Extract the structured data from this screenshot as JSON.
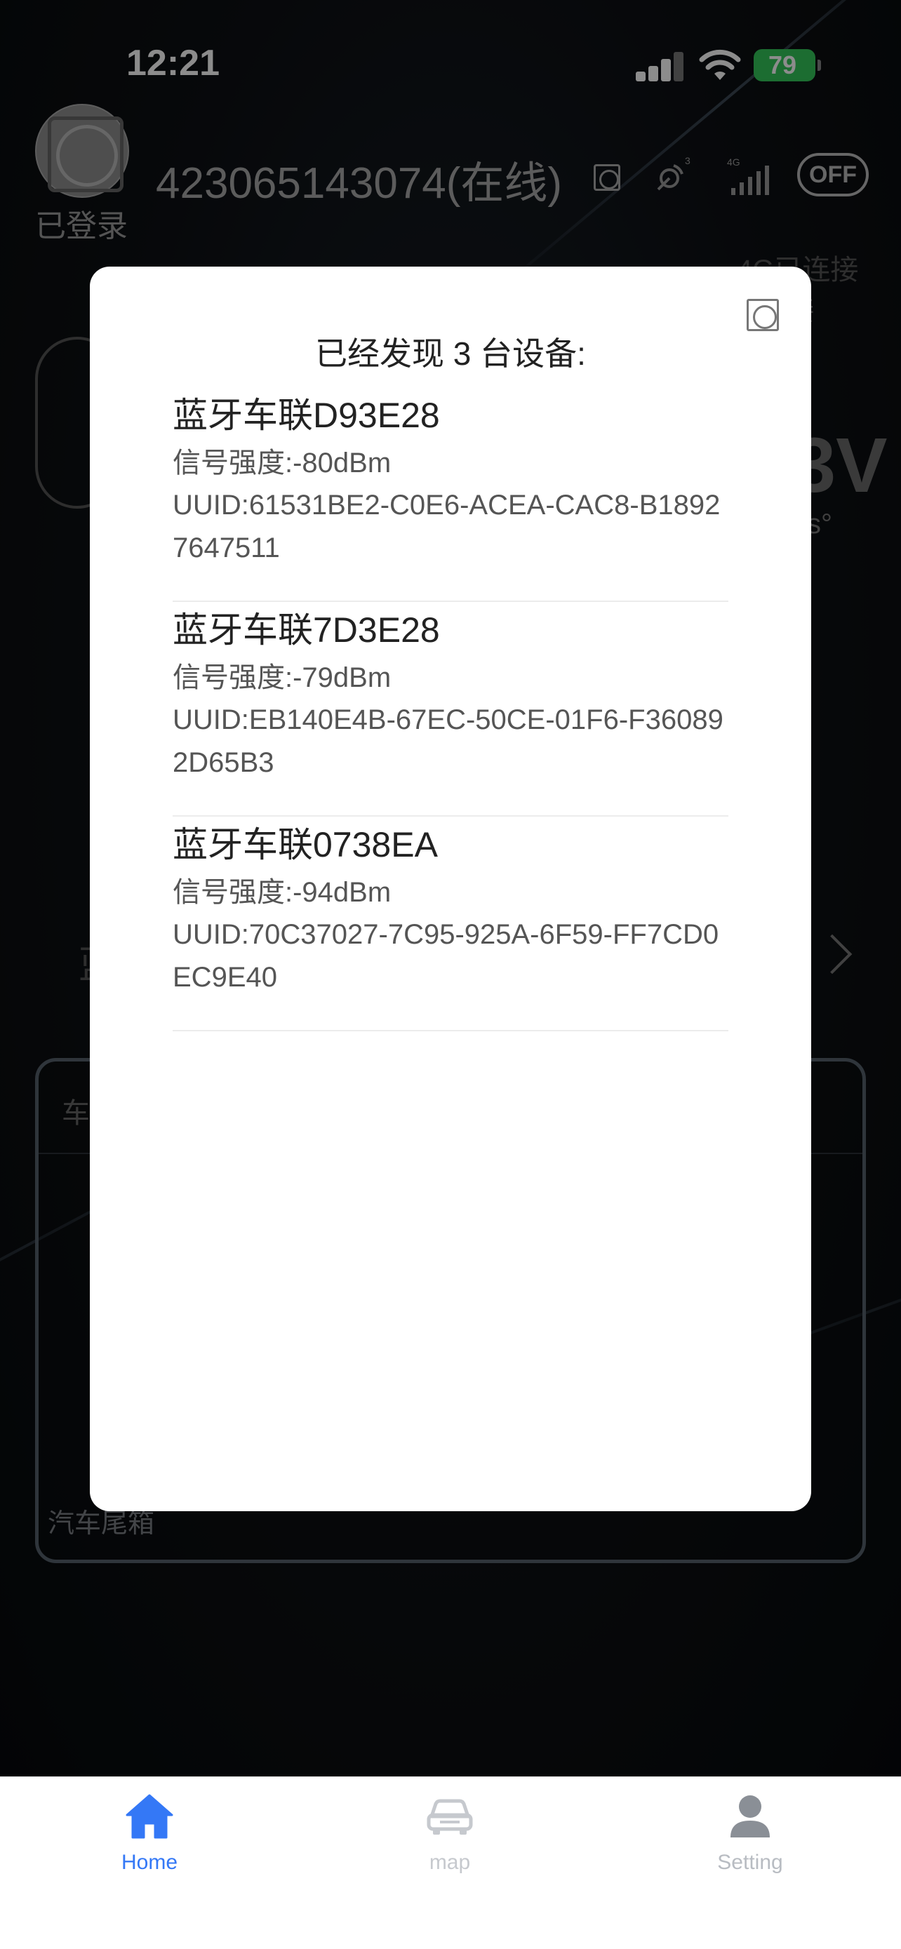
{
  "status_bar": {
    "time": "12:21",
    "battery": "79"
  },
  "background": {
    "login_label": "已登录",
    "device_id": "423065143074(在线)",
    "sat_count": "3",
    "net_type": "4G",
    "off_toggle": "OFF",
    "conn_4g": "4G已连接",
    "conn_other": "连接",
    "voltage_partial": "3V",
    "degree_partial": "s°",
    "card_left_label": "车",
    "left_partial": "蓝",
    "card_bottom_label": "汽车尾箱"
  },
  "modal": {
    "title": "已经发现 3 台设备:",
    "devices": [
      {
        "name": "蓝牙车联D93E28",
        "signal": "信号强度:-80dBm",
        "uuid": "UUID:61531BE2-C0E6-ACEA-CAC8-B18927647511"
      },
      {
        "name": "蓝牙车联7D3E28",
        "signal": "信号强度:-79dBm",
        "uuid": "UUID:EB140E4B-67EC-50CE-01F6-F360892D65B3"
      },
      {
        "name": "蓝牙车联0738EA",
        "signal": "信号强度:-94dBm",
        "uuid": "UUID:70C37027-7C95-925A-6F59-FF7CD0EC9E40"
      }
    ]
  },
  "tabbar": {
    "home": "Home",
    "map": "map",
    "setting": "Setting",
    "active_color": "#3478f6"
  },
  "icons": {
    "close": "close-icon",
    "home": "home-icon",
    "map": "car-icon",
    "setting": "person-icon"
  }
}
